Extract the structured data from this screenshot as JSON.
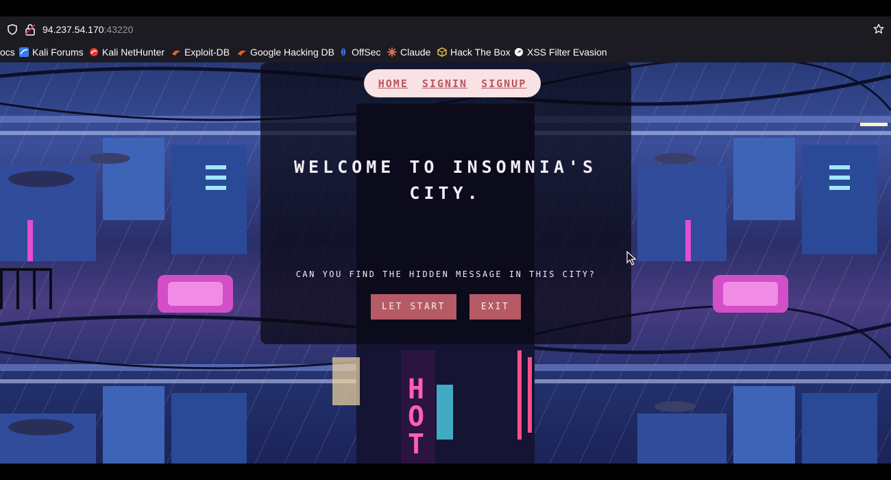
{
  "browser": {
    "url_host": "94.237.54.170",
    "url_port": ":43220",
    "bookmarks": [
      {
        "label": "ocs",
        "icon": "docs-icon"
      },
      {
        "label": "Kali Forums",
        "icon": "kali-forums-icon"
      },
      {
        "label": "Kali NetHunter",
        "icon": "kali-nethunter-icon"
      },
      {
        "label": "Exploit-DB",
        "icon": "exploit-db-icon"
      },
      {
        "label": "Google Hacking DB",
        "icon": "ghdb-icon"
      },
      {
        "label": "OffSec",
        "icon": "offsec-icon"
      },
      {
        "label": "Claude",
        "icon": "claude-icon"
      },
      {
        "label": "Hack The Box",
        "icon": "htb-icon"
      },
      {
        "label": "XSS Filter Evasion",
        "icon": "xss-icon"
      }
    ]
  },
  "nav": {
    "home": "HOME",
    "signin": "SIGNIN",
    "signup": "SIGNUP"
  },
  "hero": {
    "title": "WELCOME TO INSOMNIA'S CITY.",
    "question": "CAN YOU FIND THE HIDDEN MESSAGE IN THIS CITY?",
    "start_label": "LET START",
    "exit_label": "EXIT"
  },
  "colors": {
    "nav_bg": "#f9e2e4",
    "nav_link": "#b8545f",
    "button_bg": "#b65a66",
    "browser_bg": "#1c1b22"
  }
}
